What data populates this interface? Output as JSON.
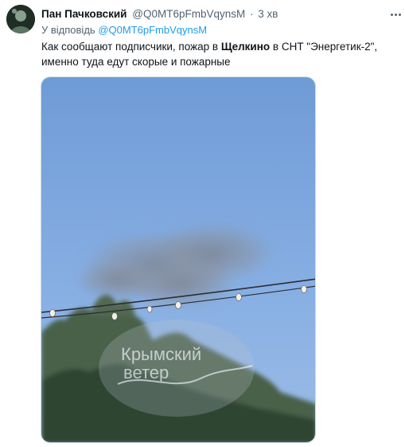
{
  "tweet": {
    "author_name": "Пан Пачковский",
    "author_handle": "@Q0MT6pFmbVqynsM",
    "separator": "·",
    "time": "3 хв",
    "reply_prefix": "У відповідь",
    "reply_handle": "@Q0MT6pFmbVqynsM",
    "text_part1": "Как сообщают подписчики, пожар в ",
    "text_bold": "Щелкино",
    "text_part2": " в СНТ \"Энергетик-2\", именно туда едут скорые и пожарные"
  },
  "media": {
    "watermark_line1": "Крымский",
    "watermark_line2": "ветер"
  },
  "icons": {
    "more": "more-dots-icon"
  }
}
